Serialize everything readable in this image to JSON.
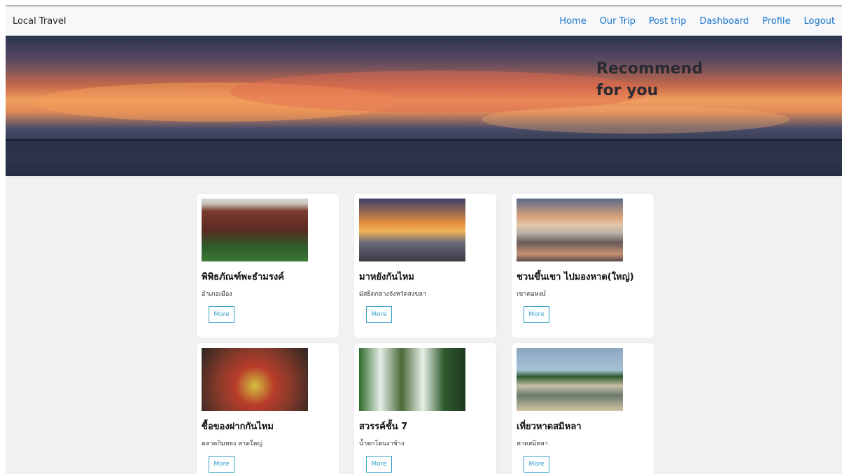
{
  "navbar": {
    "brand": "Local Travel",
    "links": [
      "Home",
      "Our Trip",
      "Post trip",
      "Dashboard",
      "Profile",
      "Logout"
    ]
  },
  "hero": {
    "title": "Recommend\nfor you"
  },
  "cards": [
    {
      "title": "พิพิธภัณฑ์พะธำมรงค์",
      "subtitle": "อำเภอเมือง",
      "button": "More"
    },
    {
      "title": "มาหยังกันไหม",
      "subtitle": "มัสยิดกลางจังหวัดสงขลา",
      "button": "More"
    },
    {
      "title": "ชวนขึ้นเขา ไปมองหาด(ใหญ่)",
      "subtitle": "เขาคอหงษ์",
      "button": "More"
    },
    {
      "title": "ซื้อของฝากกันไหม",
      "subtitle": "ตลาดกิมหยง หาดใหญ่",
      "button": "More"
    },
    {
      "title": "สวรรค์ชั้น 7",
      "subtitle": "น้ำตกโตนงาช้าง",
      "button": "More"
    },
    {
      "title": "เที่ยวหาดสมิหลา",
      "subtitle": "หาดสมิหลา",
      "button": "More"
    }
  ],
  "colors": {
    "link": "#1a73c8",
    "button_border": "#38a0c8"
  }
}
